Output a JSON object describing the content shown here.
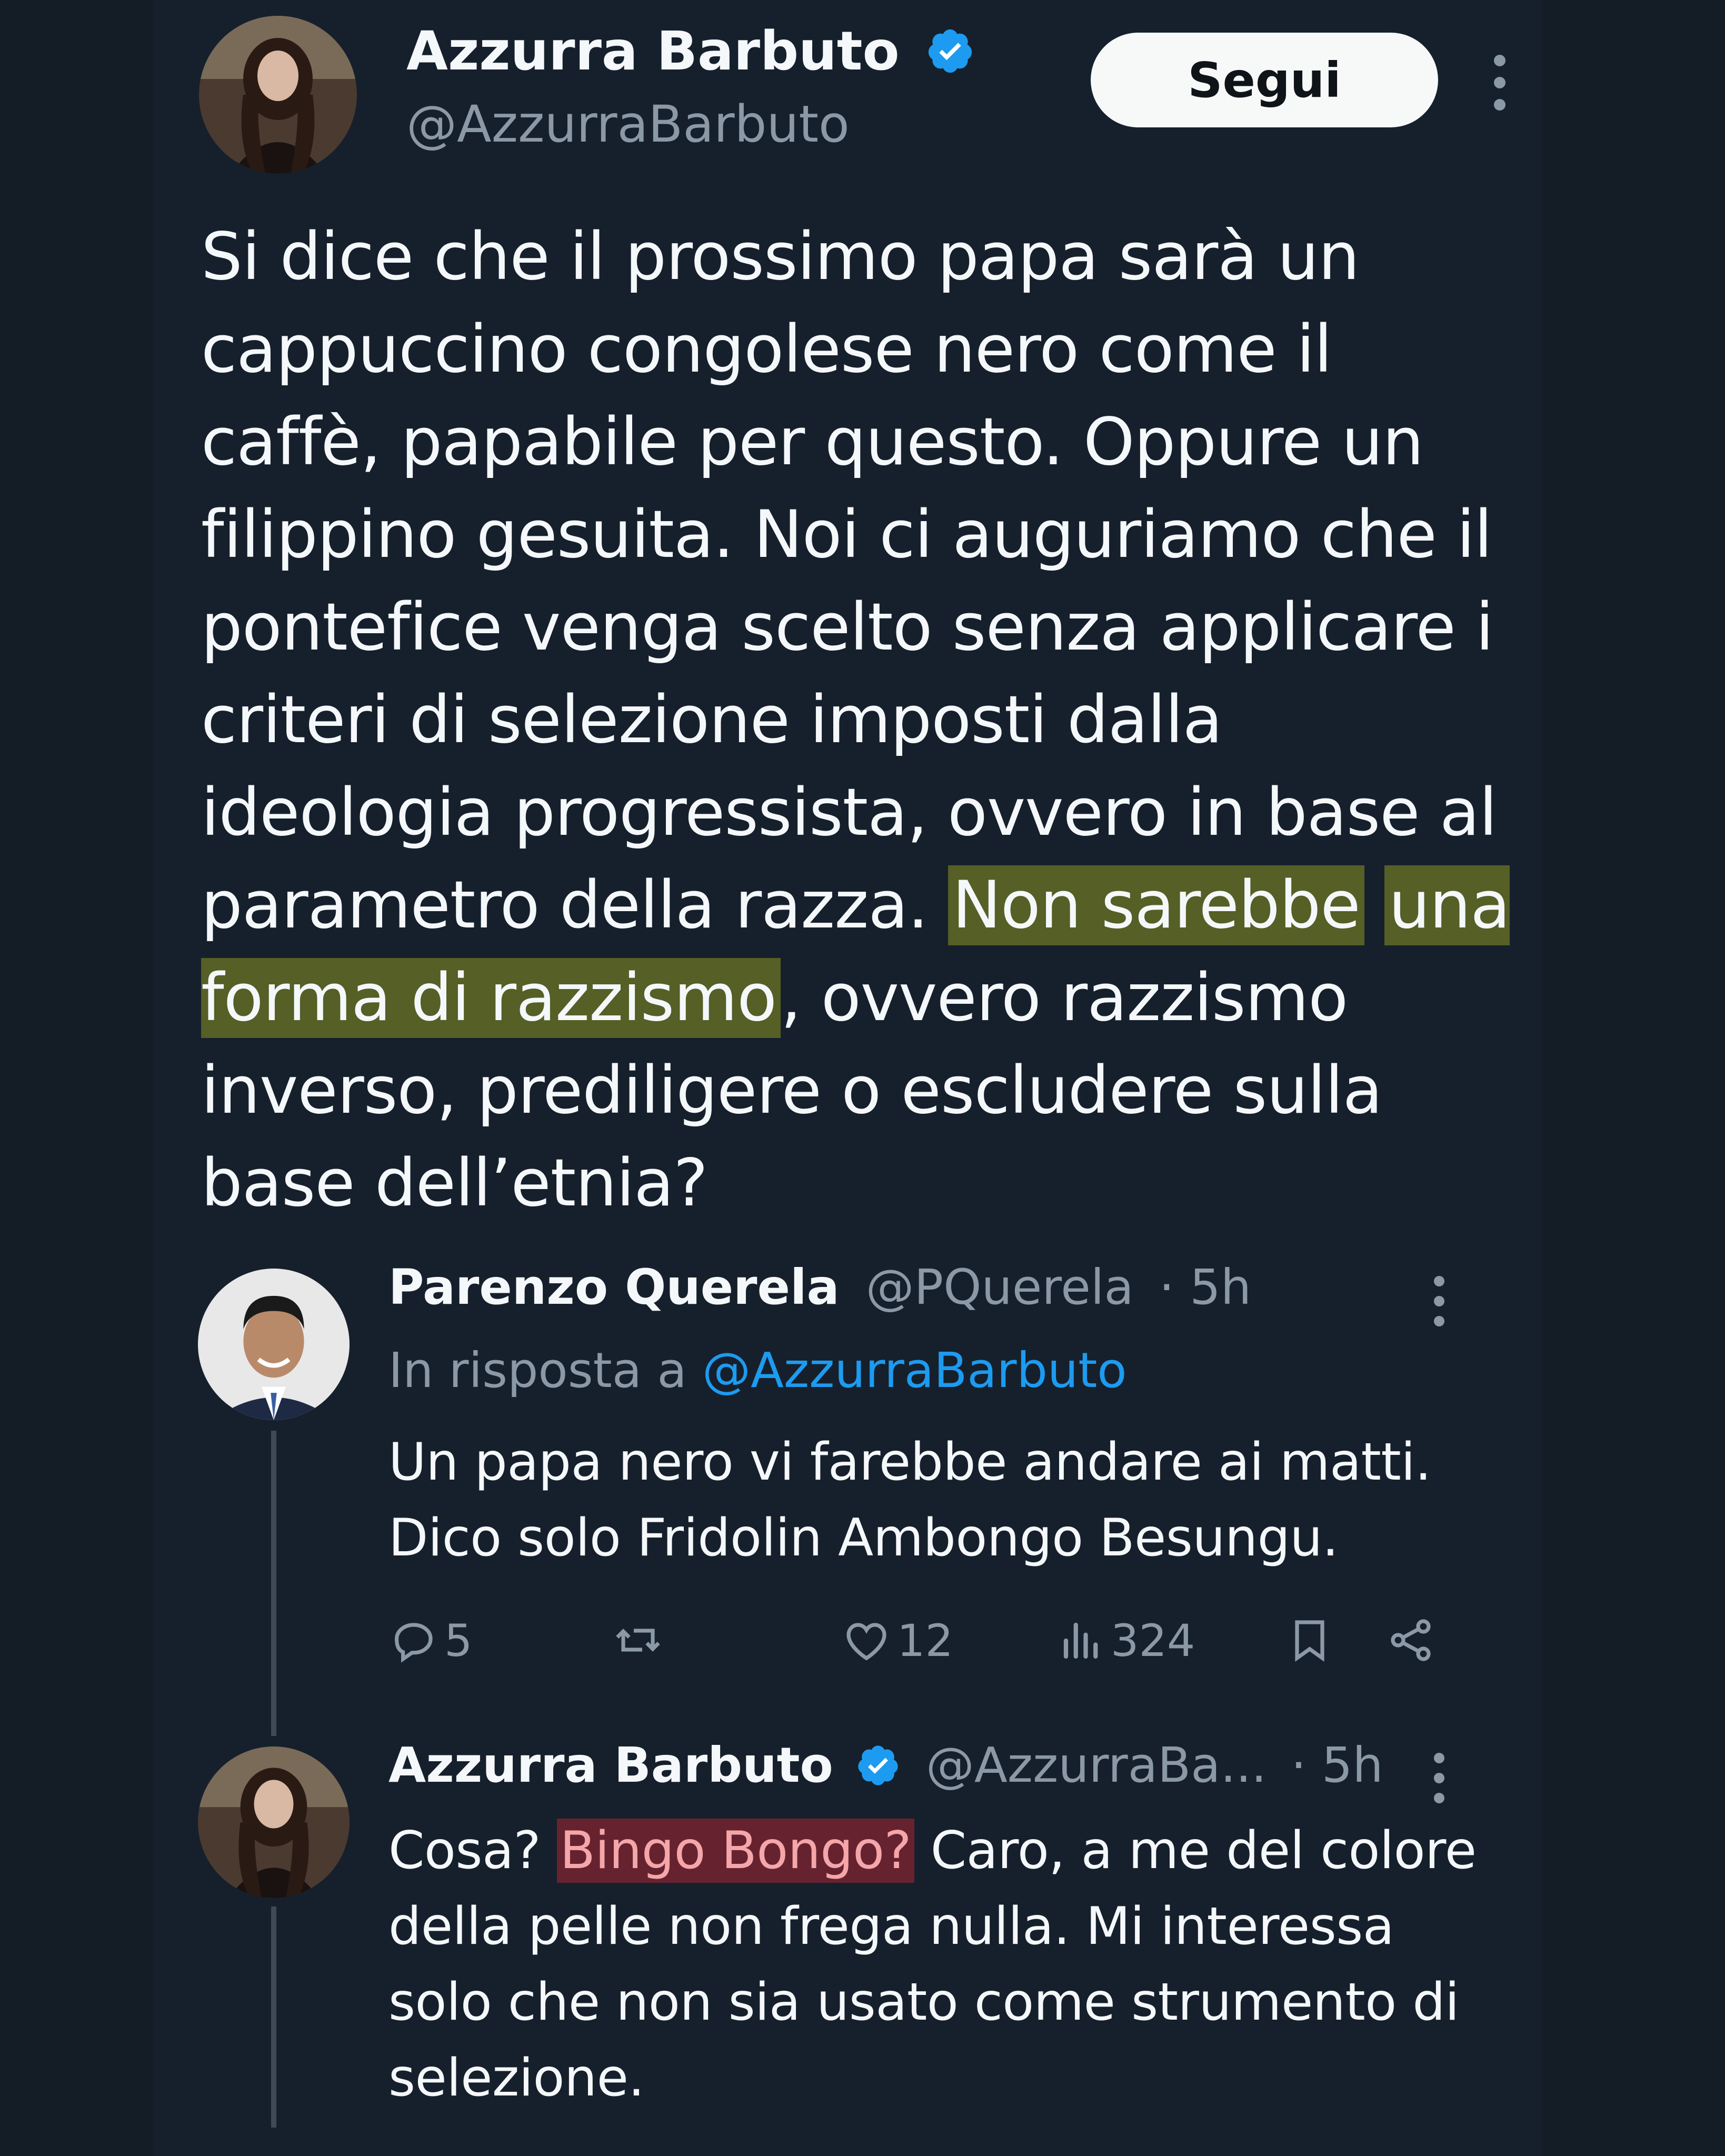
{
  "tweet": {
    "author_name": "Azzurra Barbuto",
    "author_handle": "@AzzurraBarbuto",
    "follow_label": "Segui",
    "text_before": "Si dice che il prossimo papa sarà un cappuccino congolese nero come il caffè, papabile per questo. Oppure un filippino gesuita. Noi ci auguriamo che il pontefice venga scelto senza applicare i criteri di selezione imposti dalla ideologia progressista, ovvero in base al parametro della razza. ",
    "text_highlight_1": "Non sarebbe",
    "text_highlight_2": "una forma di razzismo",
    "text_after": ", ovvero razzismo inverso, prediligere o escludere sulla base dell’etnia?"
  },
  "reply1": {
    "author_name": "Parenzo Querela",
    "author_handle": "@PQuerela",
    "time": "· 5h",
    "reply_to_prefix": "In risposta a",
    "reply_to_handle": "@AzzurraBarbuto",
    "text": "Un papa nero vi farebbe andare ai matti. Dico solo Fridolin Ambongo Besungu.",
    "replies_count": "5",
    "likes_count": "12",
    "views_count": "324"
  },
  "reply2": {
    "author_name": "Azzurra Barbuto",
    "author_handle": "@AzzurraBa...",
    "time": "· 5h",
    "text_before": "Cosa? ",
    "text_highlight": "Bingo Bongo?",
    "text_after": " Caro, a me del colore della pelle non frega nulla. Mi interessa solo che non sia usato come strumento di selezione."
  },
  "colors": {
    "background": "#16202c",
    "text": "#f5f8fa",
    "secondary": "#8b98a5",
    "accent": "#1d9bf0",
    "highlight_yellow": "#bec81e",
    "highlight_red": "#c82832"
  },
  "icons": [
    "verified-badge-icon",
    "more-options-icon",
    "reply-icon",
    "retweet-icon",
    "like-icon",
    "views-icon",
    "bookmark-icon",
    "share-icon"
  ]
}
